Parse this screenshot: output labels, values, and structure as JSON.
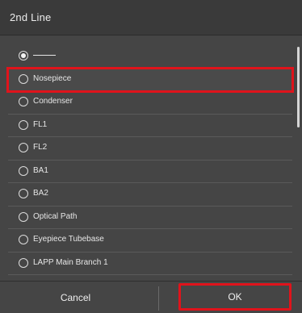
{
  "dialog": {
    "title": "2nd Line"
  },
  "options": [
    {
      "label": "——",
      "selected": true
    },
    {
      "label": "Nosepiece",
      "selected": false
    },
    {
      "label": "Condenser",
      "selected": false
    },
    {
      "label": "FL1",
      "selected": false
    },
    {
      "label": "FL2",
      "selected": false
    },
    {
      "label": "BA1",
      "selected": false
    },
    {
      "label": "BA2",
      "selected": false
    },
    {
      "label": "Optical Path",
      "selected": false
    },
    {
      "label": "Eyepiece Tubebase",
      "selected": false
    },
    {
      "label": "LAPP Main Branch 1",
      "selected": false
    }
  ],
  "buttons": {
    "cancel_label": "Cancel",
    "ok_label": "OK"
  },
  "colors": {
    "background": "#454545",
    "title_bar": "#3a3a3a",
    "highlight": "#e0131b",
    "text": "#e6e6e6"
  }
}
